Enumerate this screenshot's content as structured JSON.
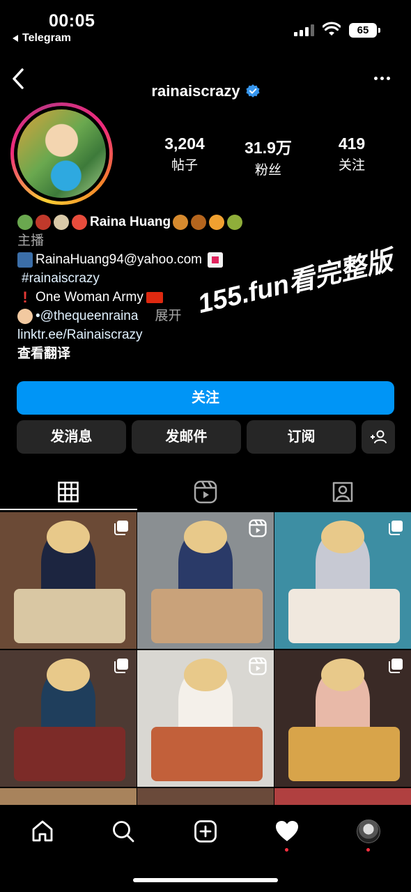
{
  "status_bar": {
    "time": "00:05",
    "back_app": "Telegram",
    "battery": "65"
  },
  "header": {
    "username": "rainaiscrazy",
    "verified": true
  },
  "stats": [
    {
      "value": "3,204",
      "label": "帖子"
    },
    {
      "value": "31.9万",
      "label": "粉丝"
    },
    {
      "value": "419",
      "label": "关注"
    }
  ],
  "bio": {
    "name": "Raina Huang",
    "category": "主播",
    "email": "RainaHuang94@yahoo.com",
    "hashtag": "#rainaiscrazy",
    "army": "One Woman Army",
    "mention": "•@thequeenraina",
    "expand": "展开",
    "link": "linktr.ee/Rainaiscrazy",
    "translate": "查看翻译"
  },
  "watermark": "155.fun看完整版",
  "actions": {
    "follow": "关注",
    "message": "发消息",
    "email": "发邮件",
    "subscribe": "订阅"
  },
  "tabs": [
    "grid-icon",
    "reels-icon",
    "tagged-icon"
  ],
  "grid": [
    {
      "type": "carousel",
      "bg": "#6b4a36",
      "plate": "#d9c7a3",
      "person": "#1c2540"
    },
    {
      "type": "reel",
      "bg": "#8a8f92",
      "plate": "#c9a27a",
      "person": "#2a3a68"
    },
    {
      "type": "carousel",
      "bg": "#3d8ea3",
      "plate": "#f0e8de",
      "person": "#c7c9d3"
    },
    {
      "type": "carousel",
      "bg": "#4d3a33",
      "plate": "#7c2b28",
      "person": "#1f3e5c"
    },
    {
      "type": "reel",
      "bg": "#d9d7d2",
      "plate": "#c2603a",
      "person": "#f4f0ea"
    },
    {
      "type": "carousel",
      "bg": "#3a2a26",
      "plate": "#d8a44a",
      "person": "#e8b9a8"
    },
    {
      "type": "partial",
      "bg": "#a8835c"
    },
    {
      "type": "partial",
      "bg": "#6a4a3a"
    },
    {
      "type": "partial",
      "bg": "#b04040"
    }
  ],
  "colors": {
    "primary": "#0095f6",
    "button_dark": "#262626",
    "notification": "#ff3040"
  }
}
